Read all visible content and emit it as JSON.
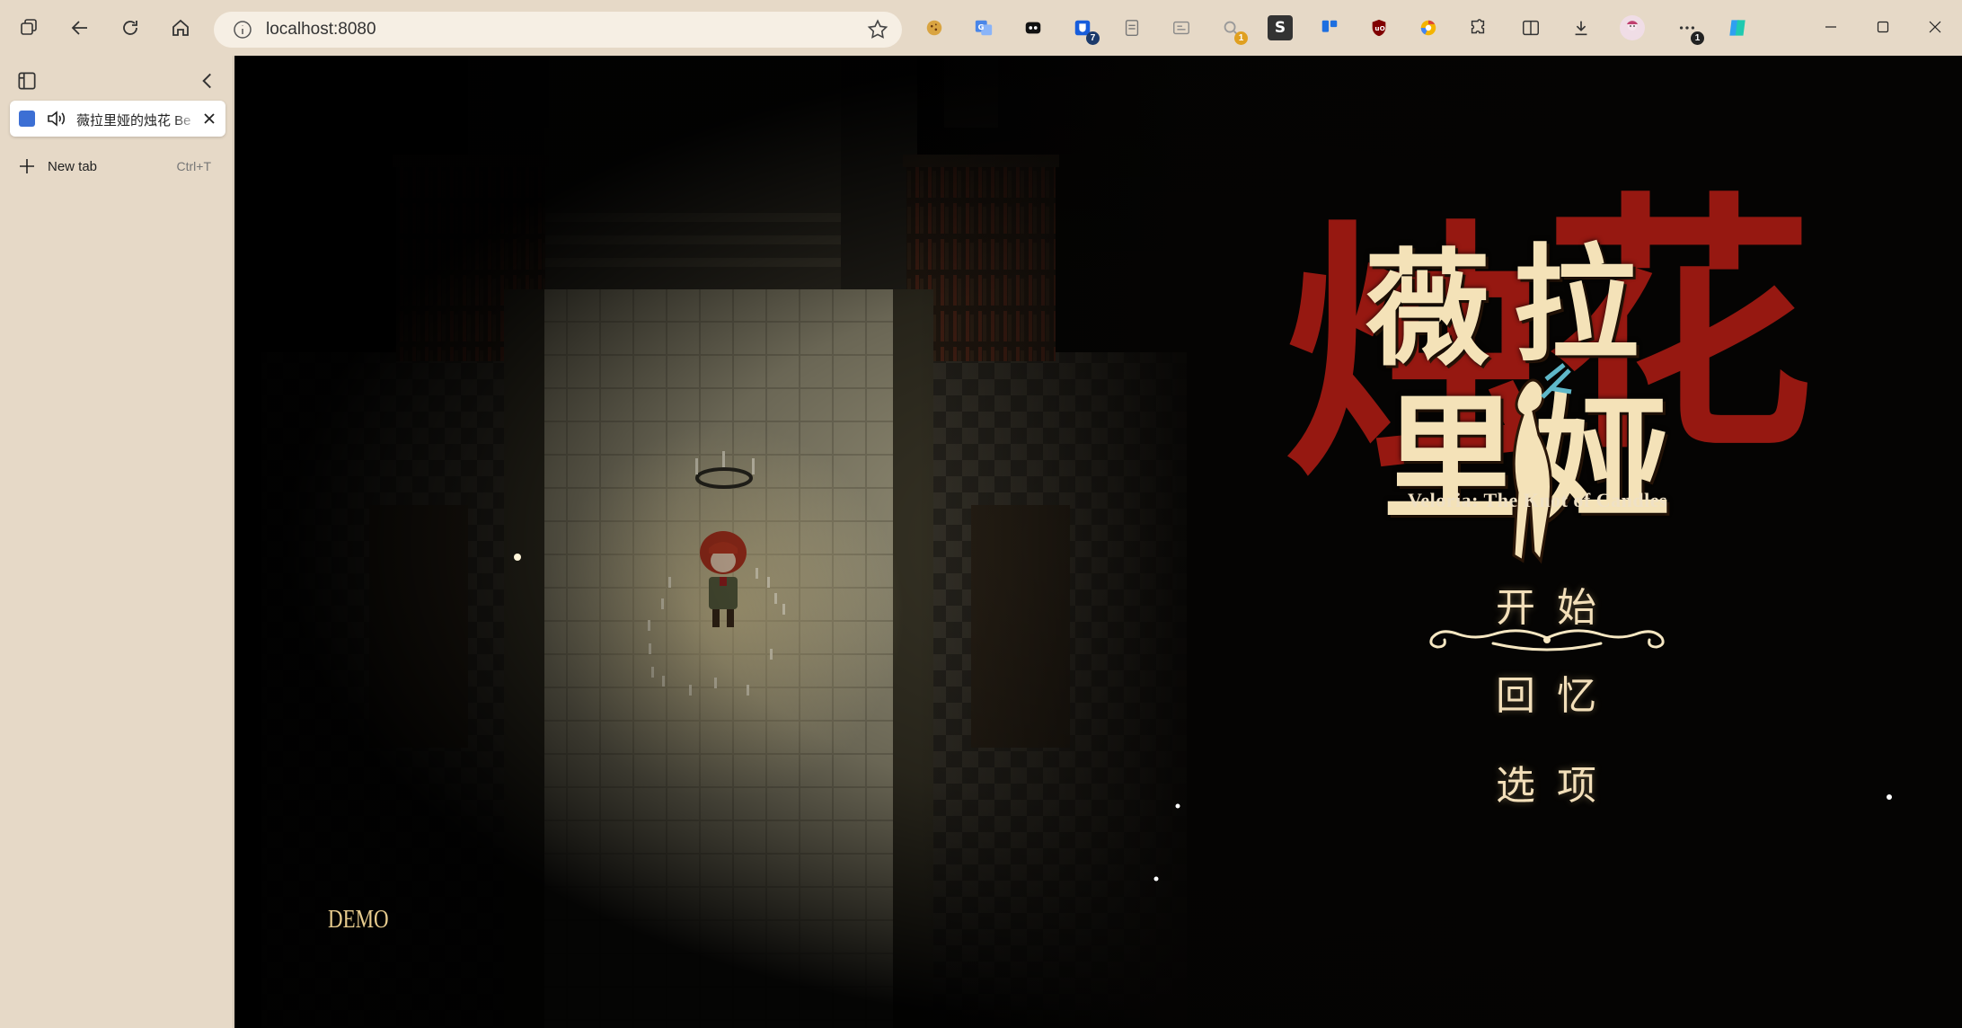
{
  "browser": {
    "url": "localhost:8080",
    "extensions": [
      {
        "icon": "cookie-icon"
      },
      {
        "icon": "translate-icon"
      },
      {
        "icon": "mask-icon"
      },
      {
        "icon": "bitwarden-icon",
        "badge": "7"
      },
      {
        "icon": "document-icon"
      },
      {
        "icon": "media-icon"
      },
      {
        "icon": "search-ext-icon",
        "badge": "1"
      },
      {
        "icon": "s-ext-icon",
        "text": "S"
      },
      {
        "icon": "trello-icon"
      },
      {
        "icon": "ublock-icon"
      },
      {
        "icon": "chrome-cast-icon"
      },
      {
        "icon": "puzzle-icon"
      }
    ],
    "more_badge": "1"
  },
  "sidebar": {
    "tab_title": "薇拉里娅的烛花 Be",
    "new_tab_label": "New tab",
    "new_tab_shortcut": "Ctrl+T"
  },
  "game": {
    "logo_chars": [
      "薇",
      "拉",
      "里",
      "娅"
    ],
    "logo_bg_chars": [
      "烛",
      "花"
    ],
    "subtitle": "Veloria: The Knot of Candles",
    "menu": {
      "start": "开始",
      "recall": "回忆",
      "options": "选项"
    },
    "demo_label": "DEMO"
  },
  "colors": {
    "chrome": "#e6d9c7",
    "logo_red": "#9e1a12",
    "logo_cream": "#f4e2b8",
    "menu_text": "#f3dfb9"
  }
}
